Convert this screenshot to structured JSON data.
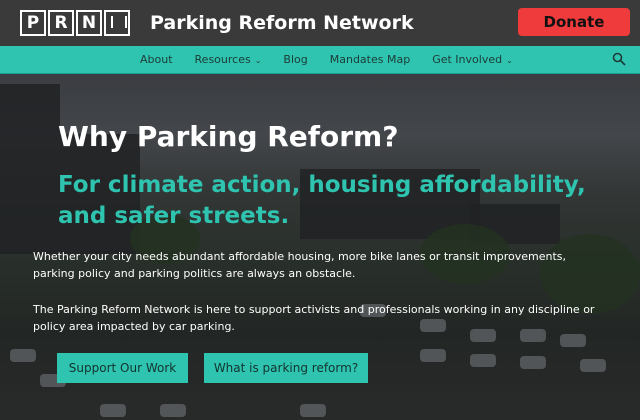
{
  "header": {
    "logo_letters": [
      "P",
      "R",
      "N",
      ""
    ],
    "site_title": "Parking Reform Network",
    "donate_label": "Donate",
    "donate_color": "#ef3b3b"
  },
  "nav": {
    "accent_color": "#2ec4b0",
    "items": [
      {
        "label": "About",
        "has_dropdown": false
      },
      {
        "label": "Resources",
        "has_dropdown": true
      },
      {
        "label": "Blog",
        "has_dropdown": false
      },
      {
        "label": "Mandates Map",
        "has_dropdown": false
      },
      {
        "label": "Get Involved",
        "has_dropdown": true
      }
    ],
    "search_icon": "search-icon",
    "chevron_icon": "chevron-down-icon"
  },
  "hero": {
    "heading": "Why Parking Reform?",
    "subheading": "For climate action, housing affordability, and safer streets.",
    "paragraph1": "Whether your city needs abundant affordable housing, more bike lanes or transit improvements, parking policy and parking politics are always an obstacle.",
    "paragraph2": "The Parking Reform Network is here to support activists and professionals working in any discipline or policy area impacted by car parking.",
    "button1_label": "Support Our Work",
    "button2_label": "What is parking reform?"
  }
}
